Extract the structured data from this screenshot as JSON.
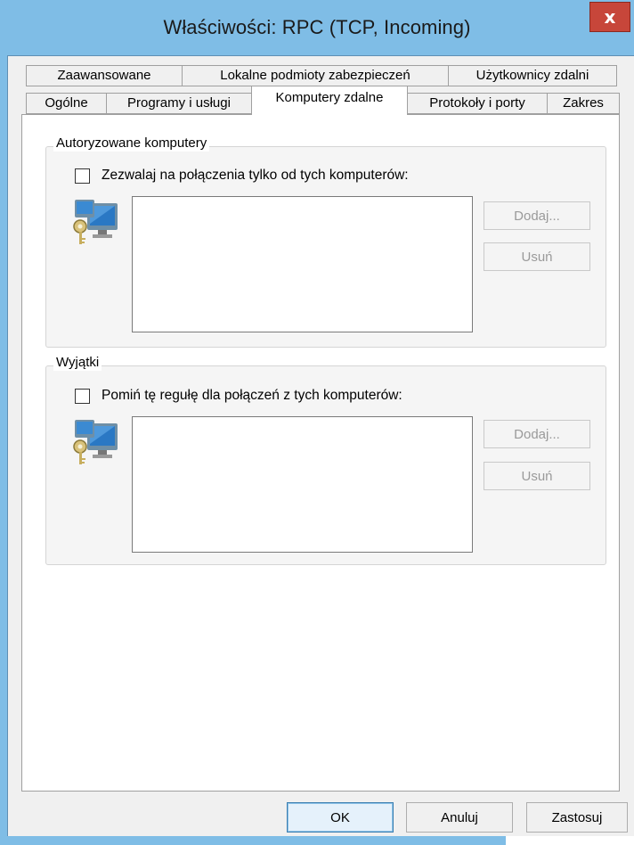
{
  "window": {
    "title": "Właściwości: RPC (TCP, Incoming)",
    "close_label": "x"
  },
  "tabs": {
    "row1": [
      {
        "label": "Zaawansowane"
      },
      {
        "label": "Lokalne podmioty zabezpieczeń"
      },
      {
        "label": "Użytkownicy zdalni"
      }
    ],
    "row2": [
      {
        "label": "Ogólne"
      },
      {
        "label": "Programy i usługi"
      },
      {
        "label": "Komputery zdalne",
        "active": true
      },
      {
        "label": "Protokoły i porty"
      },
      {
        "label": "Zakres"
      }
    ]
  },
  "authorized": {
    "group_label": "Autoryzowane komputery",
    "checkbox_label": "Zezwalaj na połączenia tylko od tych komputerów:",
    "checked": false,
    "add_label": "Dodaj...",
    "remove_label": "Usuń",
    "icon": "remote-computers-key-icon"
  },
  "exceptions": {
    "group_label": "Wyjątki",
    "checkbox_label": "Pomiń tę regułę dla połączeń z tych komputerów:",
    "checked": false,
    "add_label": "Dodaj...",
    "remove_label": "Usuń",
    "icon": "remote-computers-key-icon"
  },
  "footer": {
    "ok_label": "OK",
    "cancel_label": "Anuluj",
    "apply_label": "Zastosuj"
  },
  "colors": {
    "frame": "#7fbde6",
    "close_button": "#c7463a",
    "panel": "#ffffff",
    "dialog_bg": "#f0f0f0"
  }
}
